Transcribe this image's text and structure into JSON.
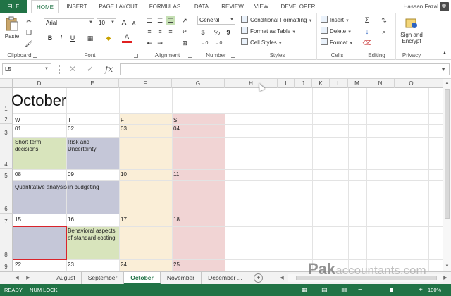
{
  "colors": {
    "accent_green": "#217346",
    "cell_green": "#d8e4bc",
    "cell_purple": "#ccc0da",
    "cell_blue_gray": "#c5c7d8",
    "fri_column": "#faeed7",
    "sat_column": "#f1d4d4",
    "selection_border": "#d9242b"
  },
  "ribbon_tabs": [
    "FILE",
    "HOME",
    "INSERT",
    "PAGE LAYOUT",
    "FORMULAS",
    "DATA",
    "REVIEW",
    "VIEW",
    "DEVELOPER"
  ],
  "user": {
    "name": "Hasaan Fazal",
    "avatar_icon": "user-avatar-icon"
  },
  "ribbon": {
    "clipboard": {
      "label": "Clipboard",
      "paste": "Paste"
    },
    "font": {
      "label": "Font",
      "font_name": "Arial",
      "font_size": "10",
      "bold": "B",
      "italic": "I",
      "underline": "U",
      "grow": "A",
      "shrink": "A",
      "font_color": "A"
    },
    "alignment": {
      "label": "Alignment"
    },
    "number": {
      "label": "Number",
      "format": "General",
      "currency": "$",
      "percent": "%",
      "comma": "9"
    },
    "styles": {
      "label": "Styles",
      "conditional": "Conditional Formatting",
      "format_table": "Format as Table",
      "cell_styles": "Cell Styles"
    },
    "cells": {
      "label": "Cells",
      "insert": "Insert",
      "delete": "Delete",
      "format": "Format"
    },
    "editing": {
      "label": "Editing"
    },
    "privacy": {
      "label": "Privacy",
      "sign_encrypt_line1": "Sign and",
      "sign_encrypt_line2": "Encrypt"
    }
  },
  "formula_bar": {
    "name_box": "L5",
    "cancel": "✕",
    "enter": "✓",
    "fx": "fx",
    "formula": ""
  },
  "columns": [
    "D",
    "E",
    "F",
    "G",
    "H",
    "I",
    "J",
    "K",
    "L",
    "M",
    "N",
    "O"
  ],
  "rows": [
    "1",
    "2",
    "3",
    "4",
    "5",
    "6",
    "7",
    "8",
    "9"
  ],
  "sheet": {
    "title": "October",
    "weekdays": [
      "W",
      "T",
      "F",
      "S"
    ],
    "dates_row3": [
      "01",
      "02",
      "03",
      "04"
    ],
    "dates_row5": [
      "08",
      "09",
      "10",
      "11"
    ],
    "dates_row7": [
      "15",
      "16",
      "17",
      "18"
    ],
    "dates_row9": [
      "22",
      "23",
      "24",
      "25"
    ],
    "events": {
      "short_term": "Short term decisions",
      "risk": "Risk and Uncertainty",
      "quantitative": "Quantitative analysis in budgeting",
      "behavioral": "Behavioral aspects of standard costing"
    }
  },
  "sheet_tabs": [
    "August",
    "September",
    "October",
    "November",
    "December ..."
  ],
  "active_sheet": "October",
  "status": {
    "ready": "READY",
    "numlock": "NUM LOCK",
    "zoom": "100%",
    "zoom_level": 0.5
  },
  "watermark": {
    "part1": "Pak",
    "part2": "accountants.com"
  }
}
